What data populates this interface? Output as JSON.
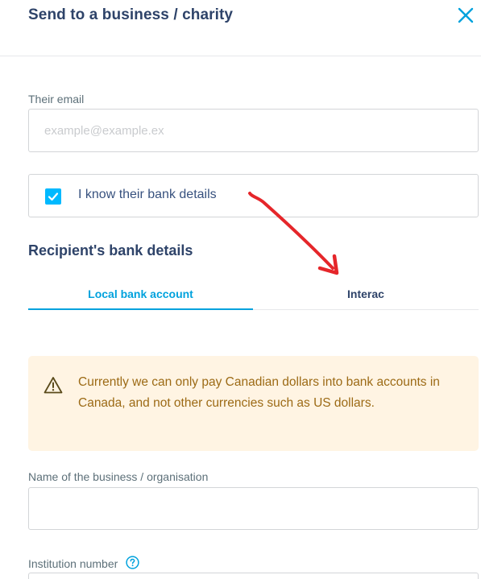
{
  "header": {
    "title": "Send to a business / charity",
    "close_icon": "close-icon"
  },
  "email": {
    "label": "Their email",
    "placeholder": "example@example.ex",
    "value": ""
  },
  "bank_details_checkbox": {
    "label": "I know their bank details",
    "checked": true
  },
  "recipient_section": {
    "title": "Recipient's bank details",
    "tabs": [
      {
        "label": "Local bank account",
        "active": true
      },
      {
        "label": "Interac",
        "active": false
      }
    ]
  },
  "alert": {
    "icon": "warning-icon",
    "text": "Currently we can only pay Canadian dollars into bank accounts in Canada, and not other currencies such as US dollars."
  },
  "business_name": {
    "label": "Name of the business / organisation",
    "value": ""
  },
  "institution_number": {
    "label": "Institution number",
    "help_icon": "help-icon"
  },
  "colors": {
    "accent": "#00a2dd",
    "checkbox": "#00b9ff",
    "heading": "#2e4369",
    "alert_bg": "#fff4e3",
    "alert_text": "#9c6a15",
    "annotation_arrow": "#e5262a"
  }
}
